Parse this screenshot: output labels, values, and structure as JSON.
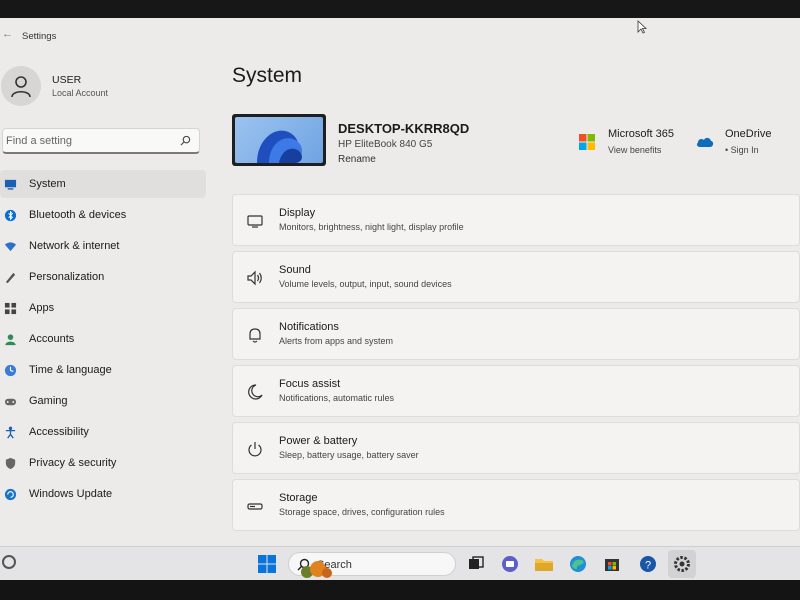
{
  "window": {
    "title": "Settings"
  },
  "profile": {
    "name": "USER",
    "account_type": "Local Account"
  },
  "search": {
    "placeholder": "Find a setting"
  },
  "nav": {
    "items": [
      {
        "label": "System",
        "icon": "system-icon",
        "active": true
      },
      {
        "label": "Bluetooth & devices",
        "icon": "bluetooth-icon"
      },
      {
        "label": "Network & internet",
        "icon": "wifi-icon"
      },
      {
        "label": "Personalization",
        "icon": "pen-icon"
      },
      {
        "label": "Apps",
        "icon": "apps-icon"
      },
      {
        "label": "Accounts",
        "icon": "person-icon"
      },
      {
        "label": "Time & language",
        "icon": "globe-clock-icon"
      },
      {
        "label": "Gaming",
        "icon": "controller-icon"
      },
      {
        "label": "Accessibility",
        "icon": "accessibility-icon"
      },
      {
        "label": "Privacy & security",
        "icon": "shield-icon"
      },
      {
        "label": "Windows Update",
        "icon": "update-icon"
      }
    ]
  },
  "page": {
    "title": "System"
  },
  "device": {
    "name": "DESKTOP-KKRR8QD",
    "model": "HP EliteBook 840 G5",
    "rename_label": "Rename"
  },
  "services": {
    "ms365": {
      "title": "Microsoft 365",
      "subtitle": "View benefits"
    },
    "onedrive": {
      "title": "OneDrive",
      "subtitle": "• Sign In"
    }
  },
  "cards": [
    {
      "title": "Display",
      "subtitle": "Monitors, brightness, night light, display profile",
      "icon": "monitor-icon"
    },
    {
      "title": "Sound",
      "subtitle": "Volume levels, output, input, sound devices",
      "icon": "speaker-icon"
    },
    {
      "title": "Notifications",
      "subtitle": "Alerts from apps and system",
      "icon": "bell-icon"
    },
    {
      "title": "Focus assist",
      "subtitle": "Notifications, automatic rules",
      "icon": "moon-icon"
    },
    {
      "title": "Power & battery",
      "subtitle": "Sleep, battery usage, battery saver",
      "icon": "power-icon"
    },
    {
      "title": "Storage",
      "subtitle": "Storage space, drives, configuration rules",
      "icon": "storage-icon"
    }
  ],
  "taskbar": {
    "search_label": "Search"
  },
  "colors": {
    "accent": "#0067c0",
    "window_bg": "#ecebea",
    "card_bg": "#f4f3f2"
  }
}
